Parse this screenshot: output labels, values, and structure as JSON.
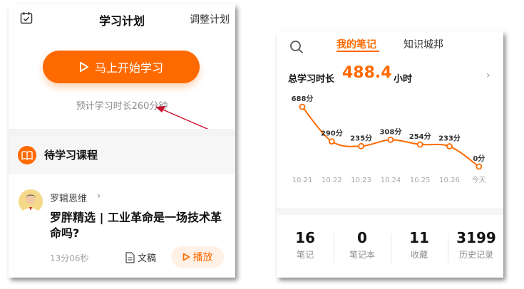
{
  "left": {
    "header": {
      "title": "学习计划",
      "action": "调整计划"
    },
    "start_button": "马上开始学习",
    "estimate": "预计学习时长260分钟",
    "section_title": "待学习课程",
    "course": {
      "author": "罗辑思维",
      "title": "罗胖精选 | 工业革命是一场技术革命吗?",
      "duration": "13分06秒",
      "doc_label": "文稿",
      "play_label": "播放"
    }
  },
  "right": {
    "tabs": [
      "我的笔记",
      "知识城邦"
    ],
    "total": {
      "label": "总学习时长",
      "value": "488.4",
      "unit": "小时"
    },
    "stats": [
      {
        "value": "16",
        "label": "笔记"
      },
      {
        "value": "0",
        "label": "笔记本"
      },
      {
        "value": "11",
        "label": "收藏"
      },
      {
        "value": "3199",
        "label": "历史记录"
      }
    ]
  },
  "colors": {
    "accent": "#ff6a00",
    "arrow": "#c8102e"
  },
  "chart_data": {
    "type": "line",
    "categories": [
      "10.21",
      "10.22",
      "10.23",
      "10.24",
      "10.25",
      "10.26",
      "今天"
    ],
    "values": [
      688,
      290,
      235,
      308,
      254,
      233,
      0
    ],
    "data_labels": [
      "688分",
      "290分",
      "235分",
      "308分",
      "254分",
      "233分",
      "0分"
    ],
    "title": "",
    "xlabel": "",
    "ylabel": "",
    "grid": false
  }
}
